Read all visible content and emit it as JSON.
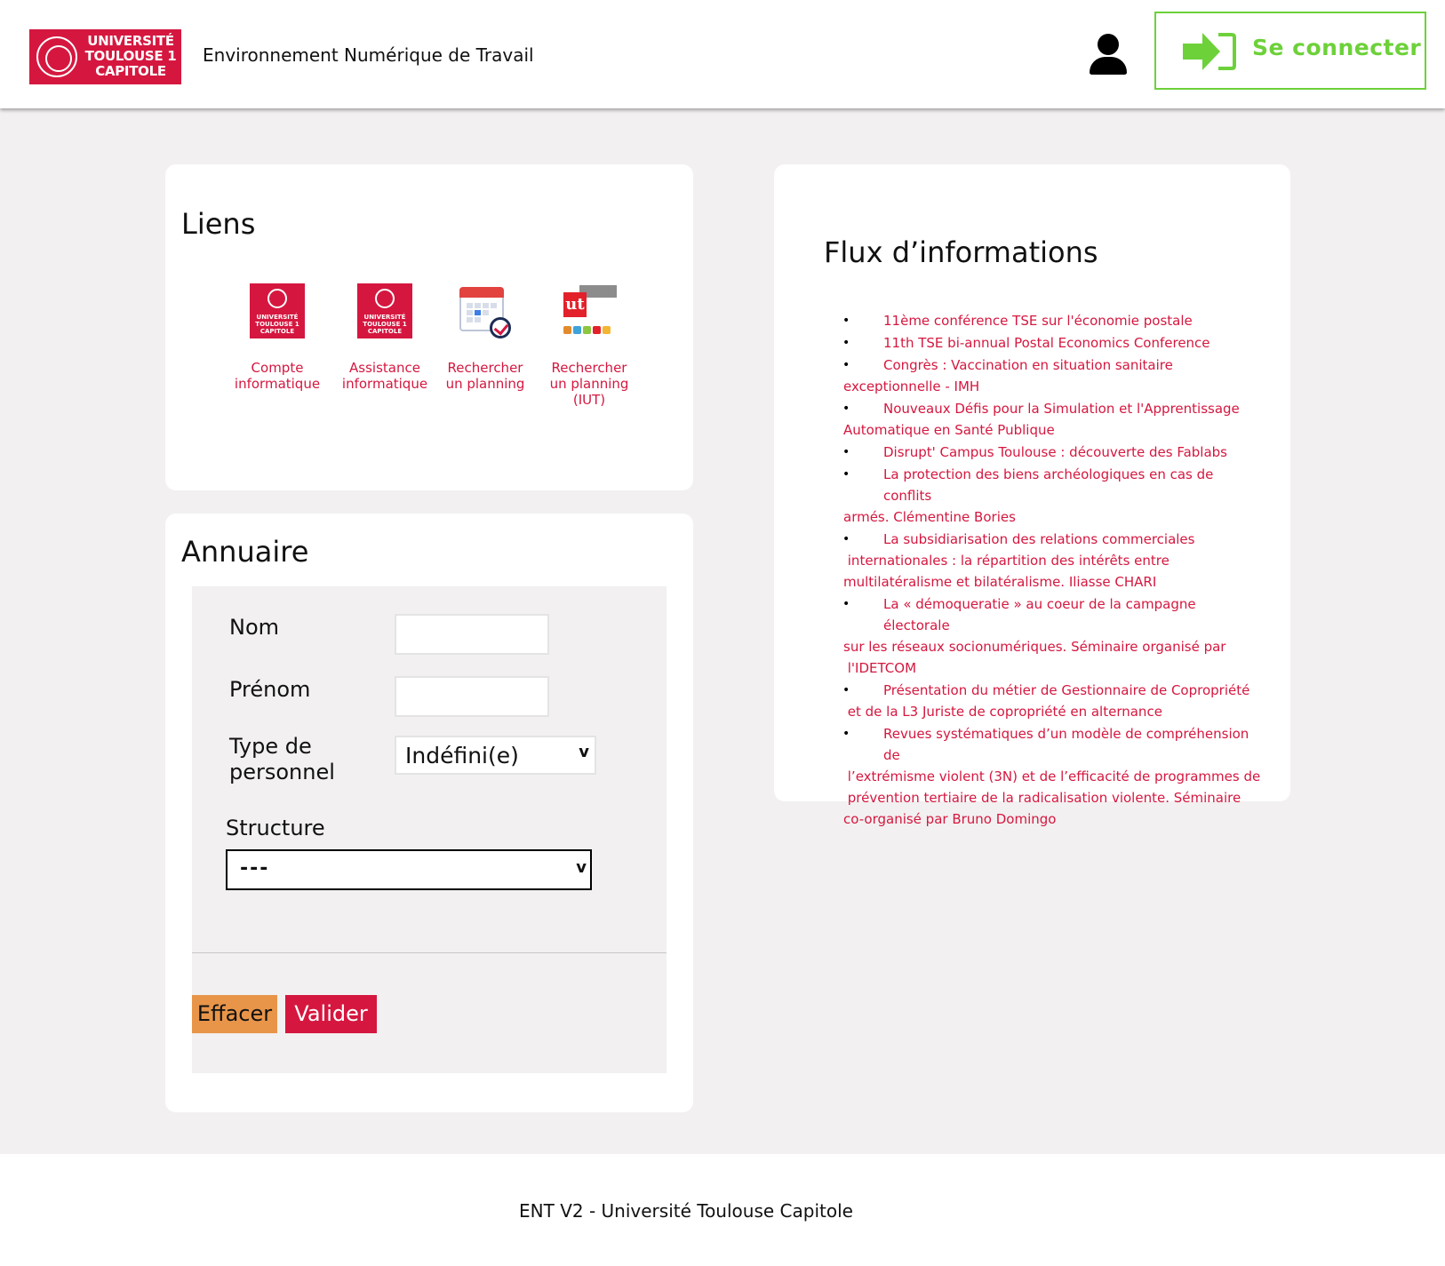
{
  "header": {
    "logo_text": "UNIVERSITÉ TOULOUSE 1 CAPITOLE",
    "app_title": "Environnement Numérique de Travail",
    "login_label": "Se connecter"
  },
  "links": {
    "title": "Liens",
    "items": [
      {
        "label": "Compte informatique",
        "icon": "ut1-logo-icon"
      },
      {
        "label": "Assistance informatique",
        "icon": "ut1-logo-icon"
      },
      {
        "label": "Rechercher un planning",
        "icon": "calendar-icon"
      },
      {
        "label": "Rechercher un planning (IUT)",
        "icon": "iut-icon"
      }
    ]
  },
  "annuaire": {
    "title": "Annuaire",
    "nom_label": "Nom",
    "nom_value": "",
    "prenom_label": "Prénom",
    "prenom_value": "",
    "type_label": "Type de personnel",
    "type_value": "Indéfini(e)",
    "structure_label": "Structure",
    "structure_value": "---",
    "effacer_label": "Effacer",
    "valider_label": "Valider"
  },
  "flux": {
    "title": "Flux d’informations",
    "items": [
      {
        "line1": "11ème conférence TSE sur l'économie postale",
        "rest": []
      },
      {
        "line1": "11th TSE bi-annual Postal Economics Conference",
        "rest": []
      },
      {
        "line1": "Congrès : Vaccination en situation sanitaire",
        "rest": [
          "exceptionnelle - IMH"
        ]
      },
      {
        "line1": "Nouveaux Défis pour la Simulation et l'Apprentissage",
        "rest": [
          "Automatique en Santé Publique"
        ]
      },
      {
        "line1": "Disrupt' Campus Toulouse : découverte des Fablabs",
        "rest": []
      },
      {
        "line1": "La protection des biens archéologiques en cas de conflits",
        "rest": [
          "armés. Clémentine Bories"
        ]
      },
      {
        "line1": "La subsidiarisation des relations commerciales",
        "rest": [
          " internationales : la répartition des intérêts entre",
          "multilatéralisme et bilatéralisme. Iliasse CHARI"
        ]
      },
      {
        "line1": "La « démoqueratie » au coeur de la campagne électorale",
        "rest": [
          "sur les réseaux socionumériques. Séminaire organisé par",
          " l'IDETCOM"
        ]
      },
      {
        "line1": "Présentation du métier de Gestionnaire de Copropriété",
        "rest": [
          " et de la L3 Juriste de copropriété en alternance"
        ]
      },
      {
        "line1": "Revues systématiques d’un modèle de compréhension de",
        "rest": [
          " l’extrémisme violent (3N) et de l’efficacité de programmes de",
          " prévention tertiaire de la radicalisation violente. Séminaire",
          "co-organisé par Bruno Domingo"
        ]
      }
    ]
  },
  "footer": {
    "text": "ENT V2 - Université Toulouse Capitole"
  },
  "colors": {
    "brand_red": "#d5173f",
    "login_green": "#6dd13a",
    "effacer_orange": "#e8954a",
    "background_gray": "#f2f0f0"
  }
}
